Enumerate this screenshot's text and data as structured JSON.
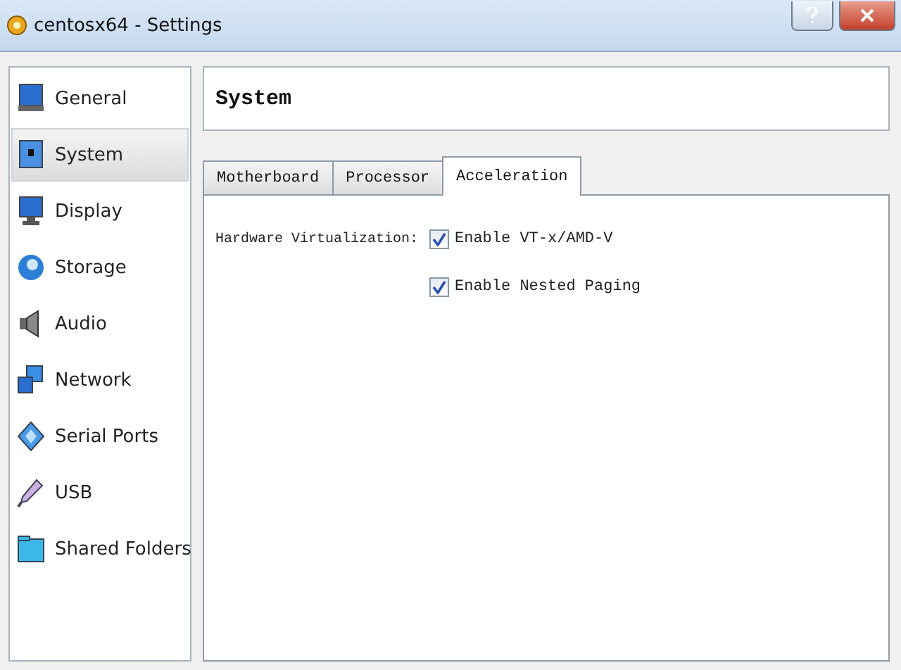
{
  "window": {
    "title": "centosx64 - Settings"
  },
  "sidebar": {
    "items": [
      {
        "label": "General",
        "selected": false
      },
      {
        "label": "System",
        "selected": true
      },
      {
        "label": "Display",
        "selected": false
      },
      {
        "label": "Storage",
        "selected": false
      },
      {
        "label": "Audio",
        "selected": false
      },
      {
        "label": "Network",
        "selected": false
      },
      {
        "label": "Serial Ports",
        "selected": false
      },
      {
        "label": "USB",
        "selected": false
      },
      {
        "label": "Shared Folders",
        "selected": false
      }
    ]
  },
  "page": {
    "title": "System"
  },
  "tabs": [
    {
      "label": "Motherboard",
      "selected": false
    },
    {
      "label": "Processor",
      "selected": false
    },
    {
      "label": "Acceleration",
      "selected": true
    }
  ],
  "acceleration": {
    "label": "Hardware Virtualization:",
    "options": [
      {
        "label": "Enable VT-x/AMD-V",
        "checked": true
      },
      {
        "label": "Enable Nested Paging",
        "checked": true
      }
    ]
  }
}
